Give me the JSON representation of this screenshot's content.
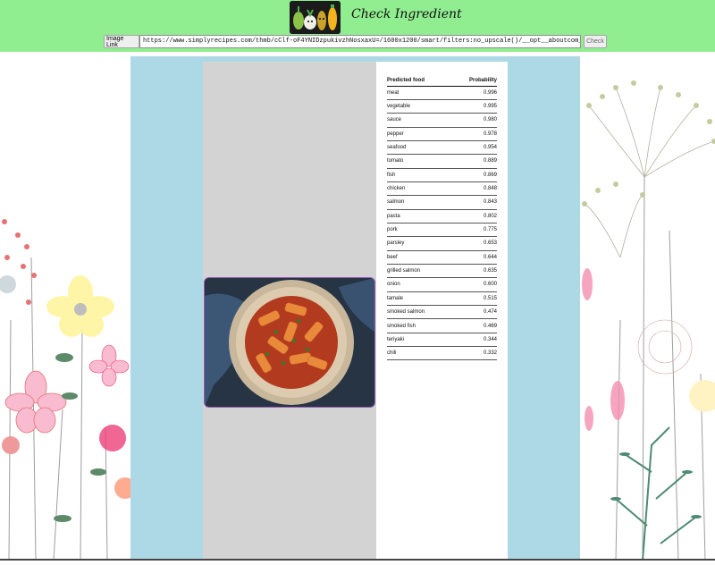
{
  "header": {
    "title": "Check Ingredient",
    "image_link_label": "Image Link",
    "url_value": "https://www.simplyrecipes.com/thmb/cClf-oF4YNIDzpukivzhNosxaxU=/1600x1200/smart/filters:no_upscale()/__opt__aboutcom__coeus__resources__content_m",
    "check_label": "Check"
  },
  "colors": {
    "header": "#90ee90",
    "panel": "#add8e6",
    "image_column": "#d3d3d3",
    "image_border": "#9b59b6"
  },
  "table": {
    "headers": [
      "Predicted food",
      "Probability"
    ],
    "rows": [
      [
        "meat",
        "0.996"
      ],
      [
        "vegetable",
        "0.995"
      ],
      [
        "sauce",
        "0.980"
      ],
      [
        "pepper",
        "0.978"
      ],
      [
        "seafood",
        "0.954"
      ],
      [
        "tomato",
        "0.889"
      ],
      [
        "fish",
        "0.869"
      ],
      [
        "chicken",
        "0.848"
      ],
      [
        "salmon",
        "0.843"
      ],
      [
        "pasta",
        "0.802"
      ],
      [
        "pork",
        "0.775"
      ],
      [
        "parsley",
        "0.653"
      ],
      [
        "beef",
        "0.644"
      ],
      [
        "grilled salmon",
        "0.635"
      ],
      [
        "onion",
        "0.600"
      ],
      [
        "tamale",
        "0.515"
      ],
      [
        "smoked salmon",
        "0.474"
      ],
      [
        "smoked fish",
        "0.469"
      ],
      [
        "teriyaki",
        "0.344"
      ],
      [
        "chili",
        "0.332"
      ]
    ]
  }
}
